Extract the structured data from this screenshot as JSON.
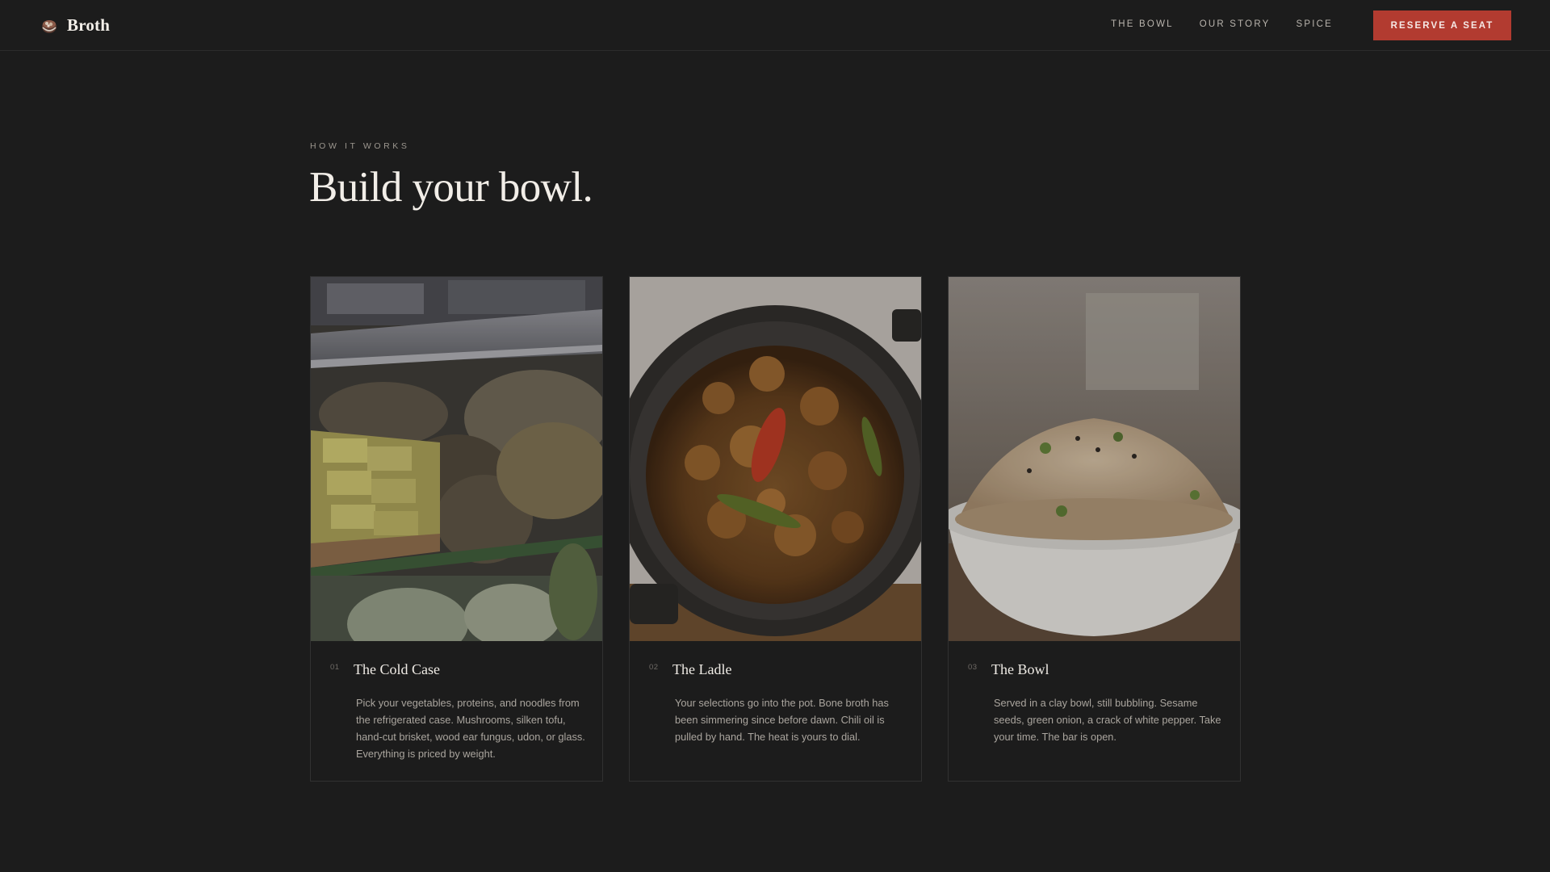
{
  "brand": {
    "name": "Broth"
  },
  "nav": {
    "items": [
      "The Bowl",
      "Our Story",
      "Spice"
    ]
  },
  "header": {
    "cta_label": "Reserve a Seat"
  },
  "section": {
    "eyebrow": "How it works",
    "title": "Build your bowl."
  },
  "cards": [
    {
      "number": "01",
      "title": "The Cold Case",
      "text": "Pick your vegetables, proteins, and noodles from the refrigerated case. Mushrooms, silken tofu, hand-cut brisket, wood ear fungus, udon, or glass. Everything is priced by weight."
    },
    {
      "number": "02",
      "title": "The Ladle",
      "text": "Your selections go into the pot. Bone broth has been simmering since before dawn. Chili oil is pulled by hand. The heat is yours to dial."
    },
    {
      "number": "03",
      "title": "The Bowl",
      "text": "Served in a clay bowl, still bubbling. Sesame seeds, green onion, a crack of white pepper. Take your time. The bar is open."
    }
  ],
  "colors": {
    "background": "#1c1c1c",
    "accent": "#b23b30",
    "text": "#e8e4de",
    "muted": "#aaa59e"
  },
  "icons": {
    "logo": "bowl-logo-icon"
  }
}
